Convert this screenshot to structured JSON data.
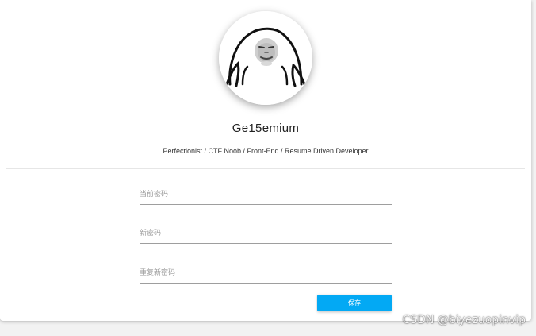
{
  "profile": {
    "username": "Ge15emium",
    "bio": "Perfectionist / CTF Noob / Front-End / Resume Driven Developer",
    "avatar_icon": "meme-face-avatar"
  },
  "form": {
    "current_password_placeholder": "当前密码",
    "new_password_placeholder": "新密码",
    "repeat_password_placeholder": "重复新密码",
    "save_label": "保存"
  },
  "watermark": {
    "text": "CSDN @biyezuopinvip"
  },
  "colors": {
    "accent": "#03a9f4",
    "card": "#ffffff",
    "background": "#f2f2f2"
  }
}
